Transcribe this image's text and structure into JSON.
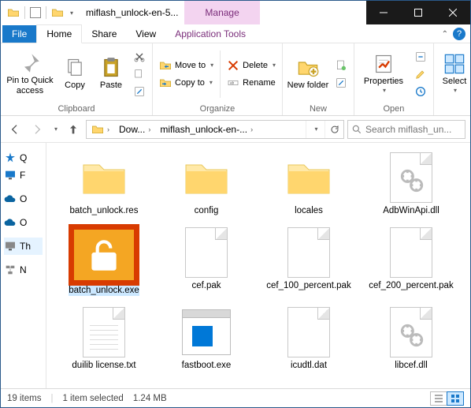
{
  "title": "miflash_unlock-en-5...",
  "context_tab": "Manage",
  "tabs": {
    "file": "File",
    "home": "Home",
    "share": "Share",
    "view": "View",
    "app_tools": "Application Tools"
  },
  "ribbon": {
    "clipboard": {
      "label": "Clipboard",
      "pin": "Pin to Quick access",
      "copy": "Copy",
      "paste": "Paste"
    },
    "organize": {
      "label": "Organize",
      "move_to": "Move to",
      "copy_to": "Copy to",
      "delete": "Delete",
      "rename": "Rename"
    },
    "new": {
      "label": "New",
      "new_folder": "New folder"
    },
    "open": {
      "label": "Open",
      "properties": "Properties"
    },
    "select": "Select"
  },
  "breadcrumbs": {
    "b1": "Dow...",
    "b2": "miflash_unlock-en-..."
  },
  "search_placeholder": "Search miflash_un...",
  "navpane": {
    "quick": "Q",
    "fast": "F",
    "one": "O",
    "one2": "O",
    "this": "Th",
    "net": "N"
  },
  "files": [
    {
      "name": "batch_unlock.res",
      "type": "folder"
    },
    {
      "name": "config",
      "type": "folder"
    },
    {
      "name": "locales",
      "type": "folder"
    },
    {
      "name": "AdbWinApi.dll",
      "type": "dll"
    },
    {
      "name": "batch_unlock.exe",
      "type": "exe_unlock",
      "selected": true
    },
    {
      "name": "cef.pak",
      "type": "file"
    },
    {
      "name": "cef_100_percent.pak",
      "type": "file"
    },
    {
      "name": "cef_200_percent.pak",
      "type": "file"
    },
    {
      "name": "duilib license.txt",
      "type": "txt"
    },
    {
      "name": "fastboot.exe",
      "type": "exe_fastboot"
    },
    {
      "name": "icudtl.dat",
      "type": "file"
    },
    {
      "name": "libcef.dll",
      "type": "dll"
    }
  ],
  "status": {
    "count": "19 items",
    "selection": "1 item selected",
    "size": "1.24 MB"
  }
}
